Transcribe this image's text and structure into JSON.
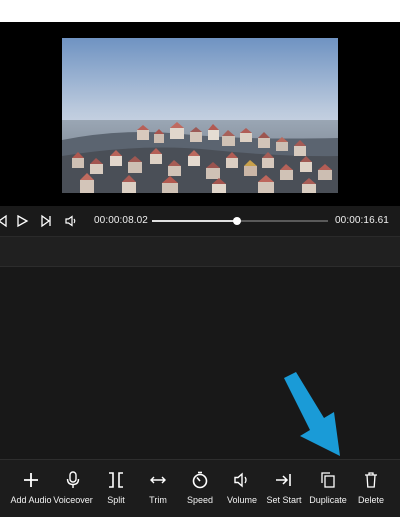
{
  "playback": {
    "current_time": "00:00:08.02",
    "total_time": "00:00:16.61",
    "progress": 0.483
  },
  "toolbar": {
    "items": [
      {
        "label": "Add Audio",
        "icon": "plus-icon"
      },
      {
        "label": "Voiceover",
        "icon": "microphone-icon"
      },
      {
        "label": "Split",
        "icon": "split-icon"
      },
      {
        "label": "Trim",
        "icon": "trim-icon"
      },
      {
        "label": "Speed",
        "icon": "speed-icon"
      },
      {
        "label": "Volume",
        "icon": "volume-icon"
      },
      {
        "label": "Set Start",
        "icon": "set-start-icon"
      },
      {
        "label": "Duplicate",
        "icon": "duplicate-icon"
      },
      {
        "label": "Delete",
        "icon": "delete-icon"
      }
    ]
  },
  "colors": {
    "accent_arrow": "#1a9bd7",
    "background": "#161616"
  }
}
